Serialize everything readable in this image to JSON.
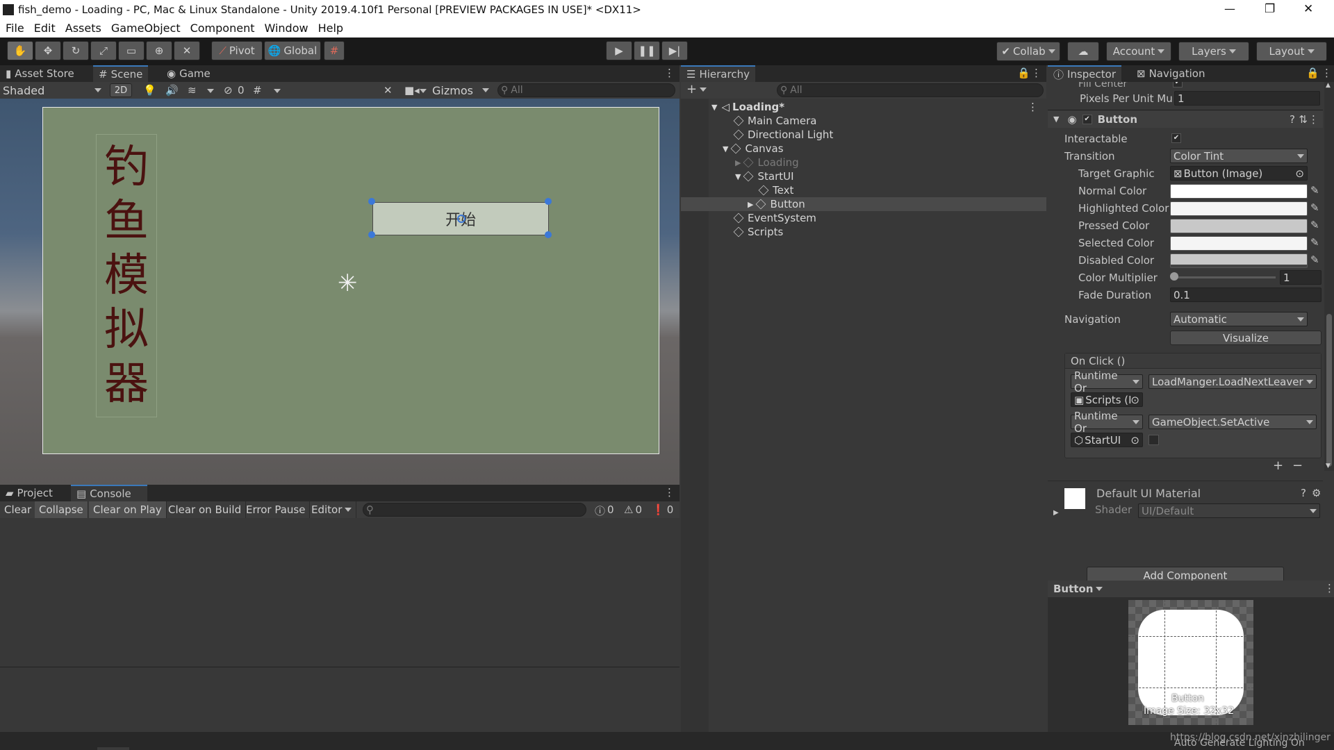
{
  "window": {
    "title": "fish_demo - Loading - PC, Mac & Linux Standalone - Unity 2019.4.10f1 Personal [PREVIEW PACKAGES IN USE]* <DX11>",
    "controls": [
      "—",
      "❐",
      "✕"
    ]
  },
  "menu": [
    "File",
    "Edit",
    "Assets",
    "GameObject",
    "Component",
    "Window",
    "Help"
  ],
  "toolbar": {
    "pivot": "Pivot",
    "global": "Global",
    "collab": "Collab",
    "account": "Account",
    "layers": "Layers",
    "layout": "Layout"
  },
  "scene_panel": {
    "tabs": [
      "Asset Store",
      "Scene",
      "Game"
    ],
    "active_tab": "Scene",
    "shading": "Shaded",
    "mode_2d": "2D",
    "hidden_count": "0",
    "gizmos": "Gizmos",
    "search_placeholder": "All",
    "title_chars": [
      "钓",
      "鱼",
      "模",
      "拟",
      "器"
    ],
    "button_text": "开始"
  },
  "console_panel": {
    "tabs": [
      "Project",
      "Console"
    ],
    "active_tab": "Console",
    "buttons": [
      "Clear",
      "Collapse",
      "Clear on Play",
      "Clear on Build",
      "Error Pause",
      "Editor"
    ],
    "log_count": "0",
    "warn_count": "0",
    "error_count": "0"
  },
  "hierarchy": {
    "tab": "Hierarchy",
    "add": "+",
    "search_placeholder": "All",
    "scene": "Loading*",
    "items": [
      "Main Camera",
      "Directional Light",
      "Canvas",
      "Loading",
      "StartUI",
      "Text",
      "Button",
      "EventSystem",
      "Scripts"
    ]
  },
  "inspector": {
    "tabs": [
      "Inspector",
      "Navigation"
    ],
    "fill_center": "Fill Center",
    "pixels_per_unit_label": "Pixels Per Unit Mu",
    "pixels_per_unit": "1",
    "component": "Button",
    "interactable": "Interactable",
    "transition_label": "Transition",
    "transition": "Color Tint",
    "target_graphic_label": "Target Graphic",
    "target_graphic": "Button (Image)",
    "normal_color": "Normal Color",
    "highlighted_color": "Highlighted Color",
    "pressed_color": "Pressed Color",
    "selected_color": "Selected Color",
    "disabled_color": "Disabled Color",
    "color_multiplier_label": "Color Multiplier",
    "color_multiplier": "1",
    "fade_duration_label": "Fade Duration",
    "fade_duration": "0.1",
    "navigation_label": "Navigation",
    "navigation": "Automatic",
    "visualize": "Visualize",
    "onclick": "On Click ()",
    "event1_mode": "Runtime Or",
    "event1_func": "LoadManger.LoadNextLeaver",
    "event1_obj": "Scripts (I",
    "event2_mode": "Runtime Or",
    "event2_func": "GameObject.SetActive",
    "event2_obj": "StartUI",
    "plus": "+",
    "minus": "−",
    "material": "Default UI Material",
    "shader_label": "Shader",
    "shader": "UI/Default",
    "add_component": "Add Component",
    "preview_title": "Button",
    "preview_caption": "Button",
    "preview_size": "Image Size: 32x32"
  },
  "status": {
    "watermark": "https://blog.csdn.net/xinzhilinger",
    "lighting": "Auto Generate Lighting On"
  }
}
